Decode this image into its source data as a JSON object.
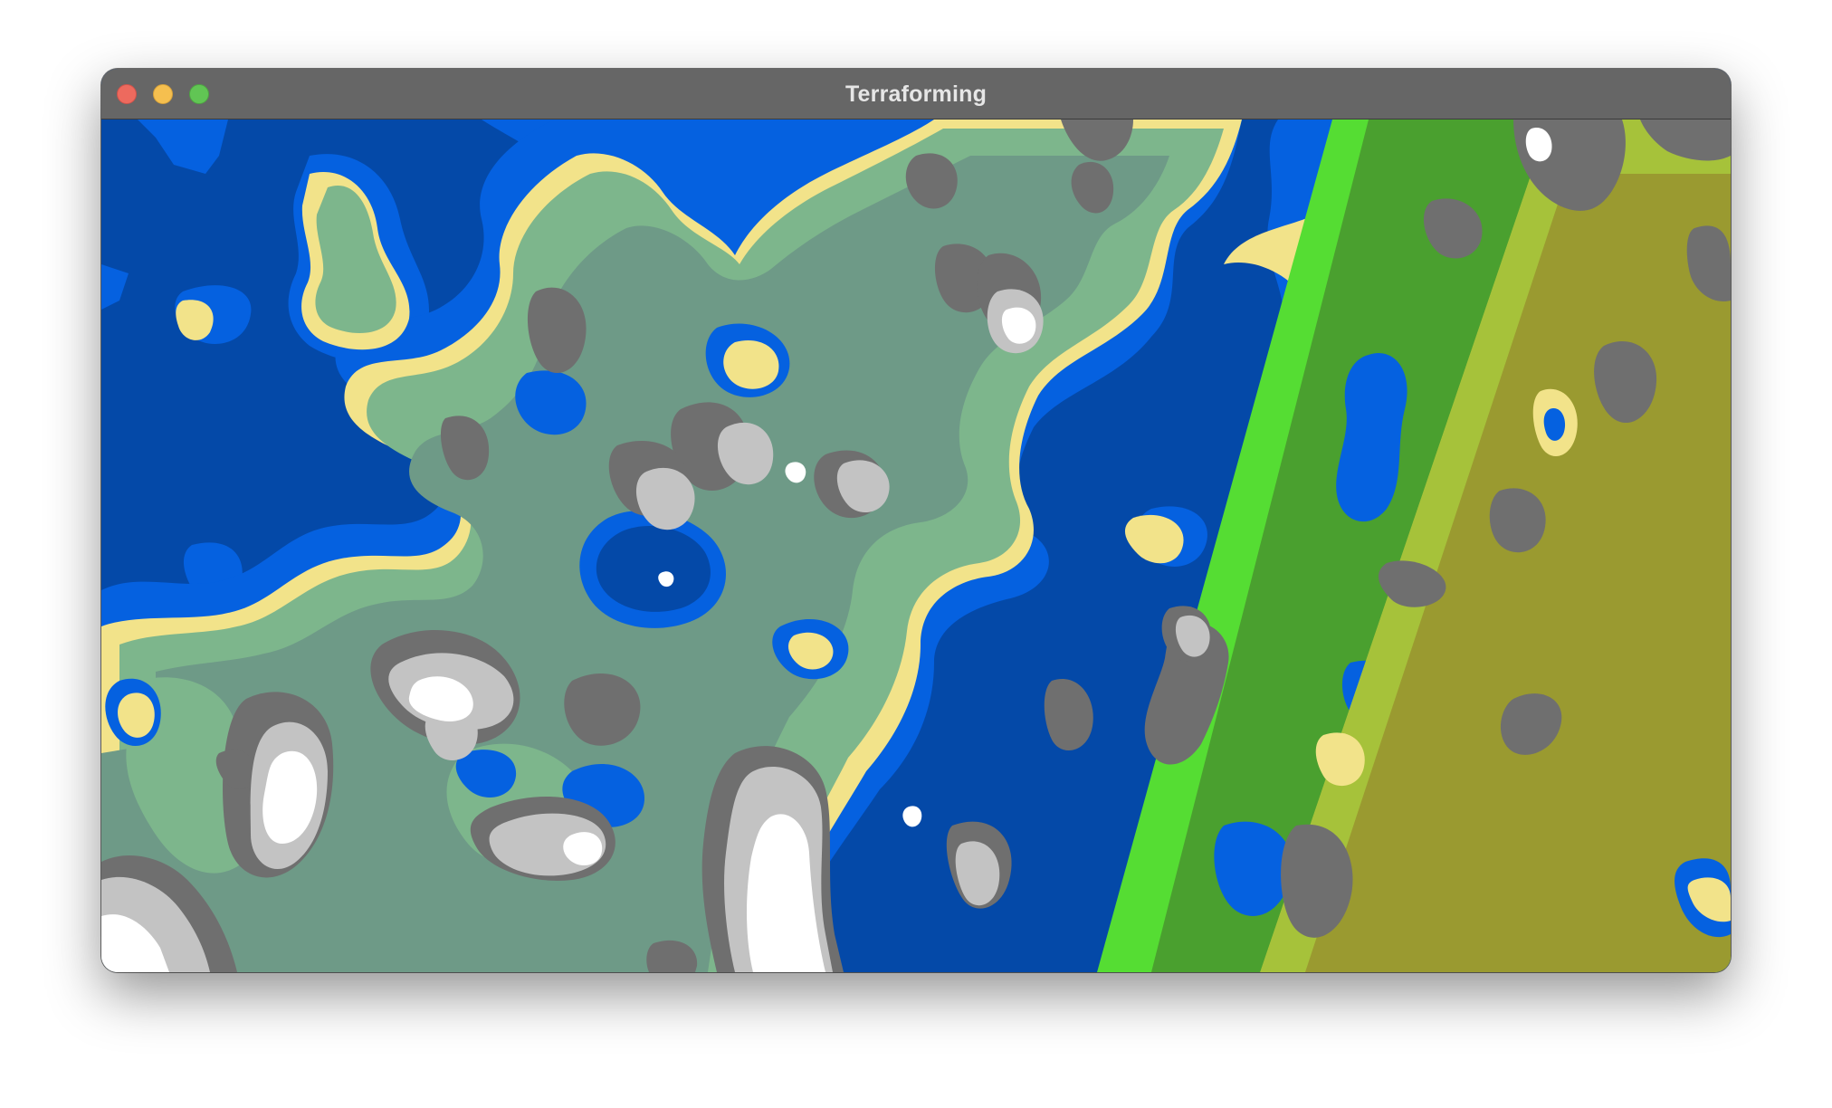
{
  "window": {
    "title": "Terraforming"
  },
  "palette": {
    "deep_water": "#0449a8",
    "shallow_water": "#0561e0",
    "sand": "#f2e38a",
    "lowland_green": "#7db68c",
    "upland_green": "#6e9a87",
    "rock": "#6f6f6f",
    "high_rock": "#c3c3c3",
    "snow": "#ffffff",
    "grass_bright": "#55dd33",
    "grass_dark": "#4aa02f",
    "olive": "#a6c23a",
    "olive_dark": "#9a9a30"
  }
}
